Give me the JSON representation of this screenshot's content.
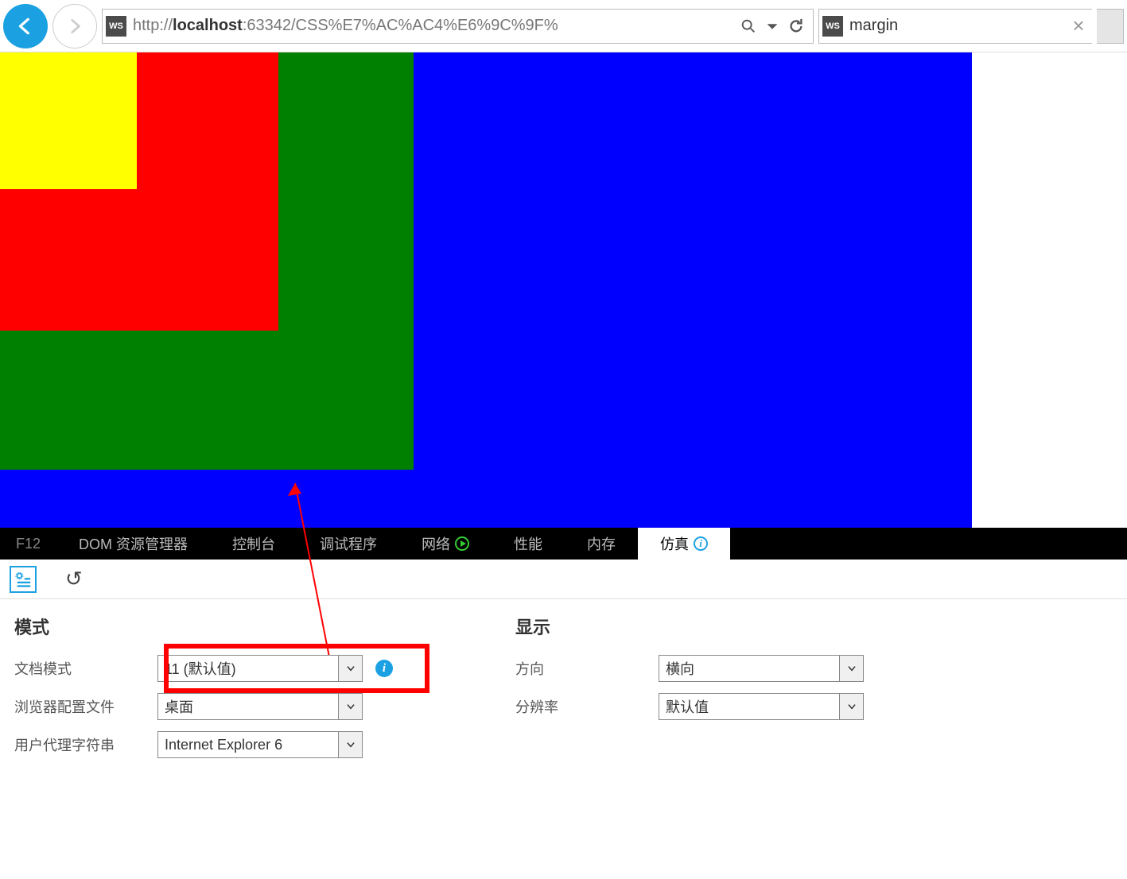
{
  "toolbar": {
    "url_prefix": "http://",
    "url_host": "localhost",
    "url_rest": ":63342/CSS%E7%AC%AC4%E6%9C%9F%",
    "page_title": "margin"
  },
  "boxes": {
    "colors": {
      "blue": "#0000ff",
      "green": "#008000",
      "red": "#ff0000",
      "yellow": "#ffff00"
    }
  },
  "devtools": {
    "tabs": {
      "f12": "F12",
      "dom": "DOM 资源管理器",
      "console": "控制台",
      "debugger": "调试程序",
      "network": "网络",
      "perf": "性能",
      "memory": "内存",
      "emulation": "仿真"
    },
    "panel": {
      "mode_title": "模式",
      "doc_mode_label": "文档模式",
      "doc_mode_value": "11 (默认值)",
      "browser_profile_label": "浏览器配置文件",
      "browser_profile_value": "桌面",
      "ua_label": "用户代理字符串",
      "ua_value": "Internet Explorer 6",
      "display_title": "显示",
      "orientation_label": "方向",
      "orientation_value": "横向",
      "resolution_label": "分辨率",
      "resolution_value": "默认值"
    }
  }
}
